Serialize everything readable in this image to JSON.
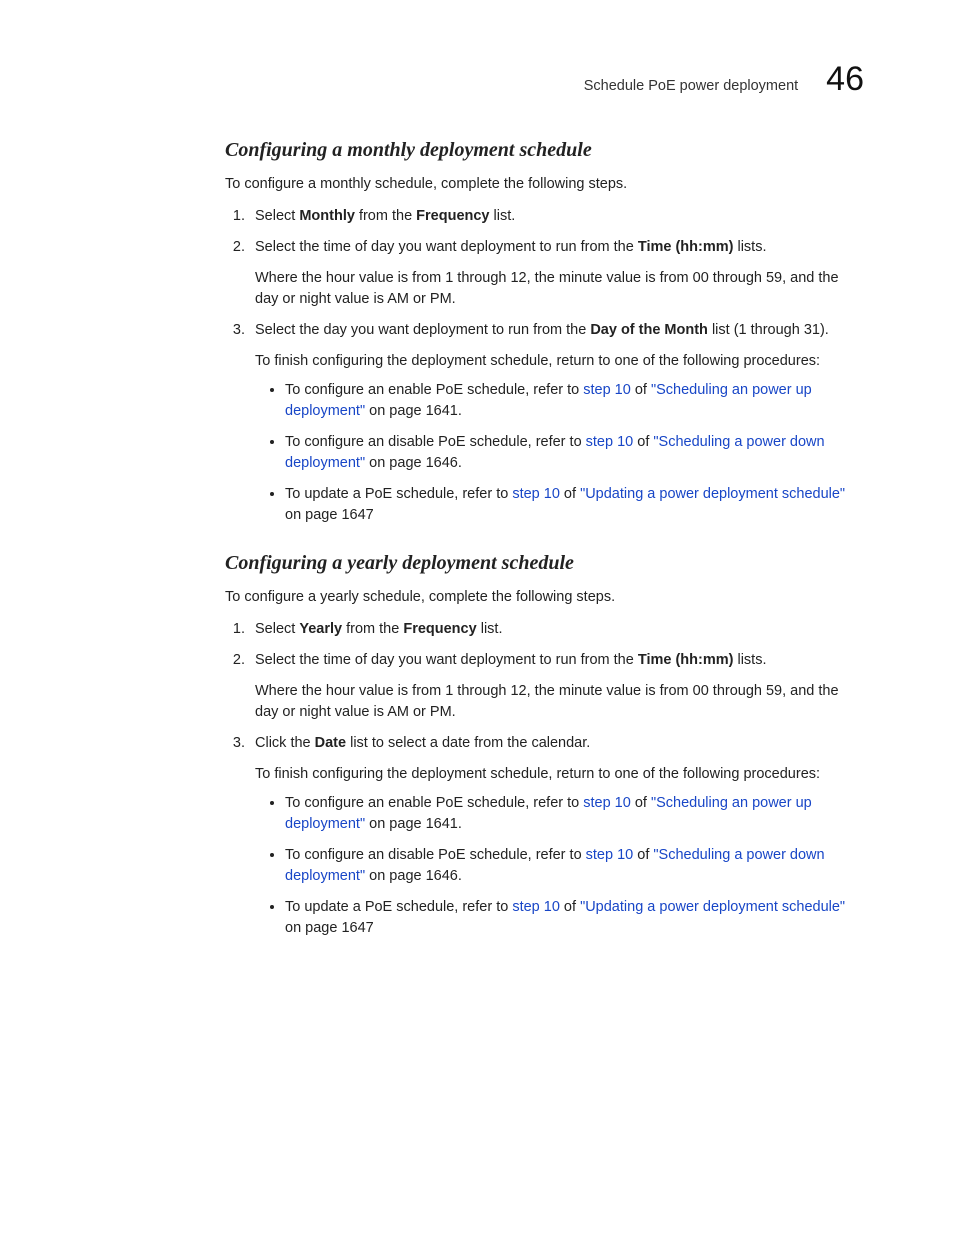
{
  "header": {
    "running_title": "Schedule PoE power deployment",
    "chapter_number": "46"
  },
  "s1": {
    "heading": "Configuring a monthly deployment schedule",
    "intro": "To configure a monthly schedule, complete the following steps.",
    "step1": {
      "a": "Select ",
      "b": "Monthly",
      "c": " from the ",
      "d": "Frequency",
      "e": " list."
    },
    "step2": {
      "a": "Select the time of day you want deployment to run from the ",
      "b": "Time (hh:mm)",
      "c": " lists."
    },
    "step2_note": "Where the hour value is from 1 through 12, the minute value is from 00 through 59, and the day or night value is AM or PM.",
    "step3": {
      "a": "Select the day you want deployment to run from the ",
      "b": "Day of the Month",
      "c": " list (1 through 31)."
    },
    "finish": "To finish configuring the deployment schedule, return to one of the following procedures:",
    "b1": {
      "a": "To configure an enable PoE schedule, refer to ",
      "step": "step 10",
      "of": " of ",
      "link": "\"Scheduling an power up deployment\"",
      "tail": " on page 1641."
    },
    "b2": {
      "a": "To configure an disable PoE schedule, refer to ",
      "step": "step 10",
      "of": " of ",
      "link": "\"Scheduling a power down deployment\"",
      "tail": " on page 1646."
    },
    "b3": {
      "a": "To update a PoE schedule, refer to ",
      "step": "step 10",
      "of": " of ",
      "link": "\"Updating a power deployment schedule\"",
      "tail": " on page 1647"
    }
  },
  "s2": {
    "heading": "Configuring a yearly deployment schedule",
    "intro": "To configure a yearly schedule, complete the following steps.",
    "step1": {
      "a": "Select ",
      "b": "Yearly",
      "c": " from the ",
      "d": "Frequency",
      "e": " list."
    },
    "step2": {
      "a": "Select the time of day you want deployment to run from the ",
      "b": "Time (hh:mm)",
      "c": " lists."
    },
    "step2_note": "Where the hour value is from 1 through 12, the minute value is from 00 through 59, and the day or night value is AM or PM.",
    "step3": {
      "a": "Click the ",
      "b": "Date",
      "c": " list to select a date from the calendar."
    },
    "finish": "To finish configuring the deployment schedule, return to one of the following procedures:",
    "b1": {
      "a": "To configure an enable PoE schedule, refer to ",
      "step": "step 10",
      "of": " of ",
      "link": "\"Scheduling an power up deployment\"",
      "tail": " on page 1641."
    },
    "b2": {
      "a": "To configure an disable PoE schedule, refer to ",
      "step": "step 10",
      "of": " of ",
      "link": "\"Scheduling a power down deployment\"",
      "tail": " on page 1646."
    },
    "b3": {
      "a": "To update a PoE schedule, refer to ",
      "step": "step 10",
      "of": " of ",
      "link": "\"Updating a power deployment schedule\"",
      "tail": " on page 1647"
    }
  }
}
